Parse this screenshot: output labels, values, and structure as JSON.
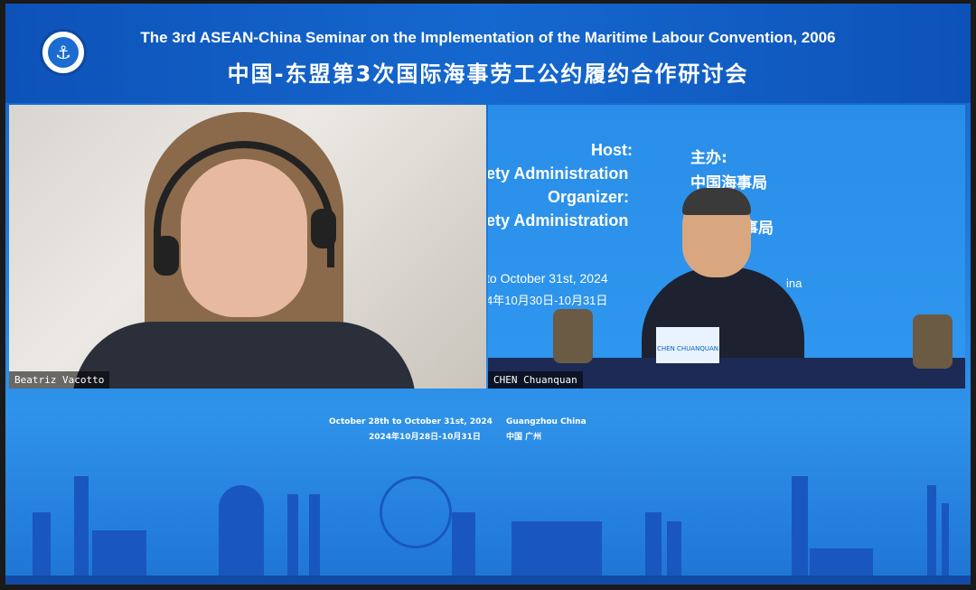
{
  "header": {
    "logo_icon": "anchor-icon",
    "logo_text": "CHINA MSA",
    "title_en": "The 3rd ASEAN-China Seminar on the Implementation of the Maritime Labour Convention, 2006",
    "title_cn": "中国-东盟第3次国际海事劳工公约履约合作研讨会"
  },
  "participants": [
    {
      "name": "Beatriz Vacotto"
    },
    {
      "name": "CHEN Chuanquan"
    }
  ],
  "backdrop": {
    "host_label": "Host:",
    "host_text": "ety Administration",
    "organizer_label": "Organizer:",
    "organizer_text": "ety Administration",
    "host_cn_label": "主办:",
    "host_cn_text": "中国海事局",
    "organizer_cn_text": "事局",
    "date_partial": "to October 31st, 2024",
    "date_partial_cn": "4年10月30日-10月31日",
    "location_partial": "ina",
    "nameplate": "CHEN CHUANQUAN"
  },
  "event_info": {
    "dates_en": "October 28th to October 31st, 2024",
    "dates_cn": "2024年10月28日-10月31日",
    "location_en": "Guangzhou China",
    "location_cn": "中国 广州"
  },
  "colors": {
    "primary_blue": "#1160c9",
    "skyline_blue": "#1957be",
    "text": "#ffffff"
  }
}
